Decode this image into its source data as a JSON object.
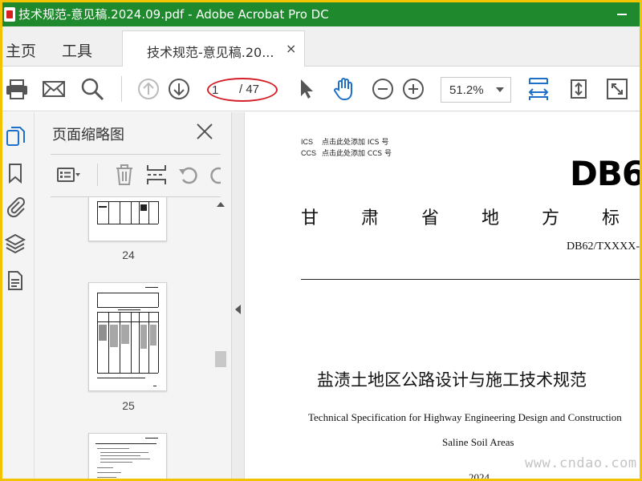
{
  "window": {
    "title": "技术规范-意见稿.2024.09.pdf - Adobe Acrobat Pro DC"
  },
  "nav": {
    "home": "主页",
    "tools": "工具"
  },
  "tab": {
    "label": "技术规范-意见稿.20...",
    "close": "×"
  },
  "toolbar": {
    "page_current": "1",
    "page_total": "/ 47",
    "zoom": "51.2%"
  },
  "panel": {
    "title": "页面缩略图",
    "thumbnails": [
      {
        "label": "24"
      },
      {
        "label": "25"
      },
      {
        "label": ""
      }
    ]
  },
  "document": {
    "ics_key": "ICS",
    "ics_value": "点击此处添加 ICS 号",
    "ccs_key": "CCS",
    "ccs_value": "点击此处添加 CCS 号",
    "logo": "DB6",
    "heading_chars": [
      "甘",
      "肃",
      "省",
      "地",
      "方",
      "标"
    ],
    "std_number": "DB62/TXXXX-",
    "cn_title": "盐渍土地区公路设计与施工技术规范",
    "en_title_line1": "Technical Specification for Highway Engineering Design and Construction",
    "en_title_line2": "Saline Soil Areas",
    "year": "2024"
  },
  "watermark": {
    "corner": "www.cndao.com"
  },
  "colors": {
    "titlebar": "#1f8a2d",
    "accent_blue": "#1e6fc9",
    "annotation_red": "#d4202a"
  }
}
